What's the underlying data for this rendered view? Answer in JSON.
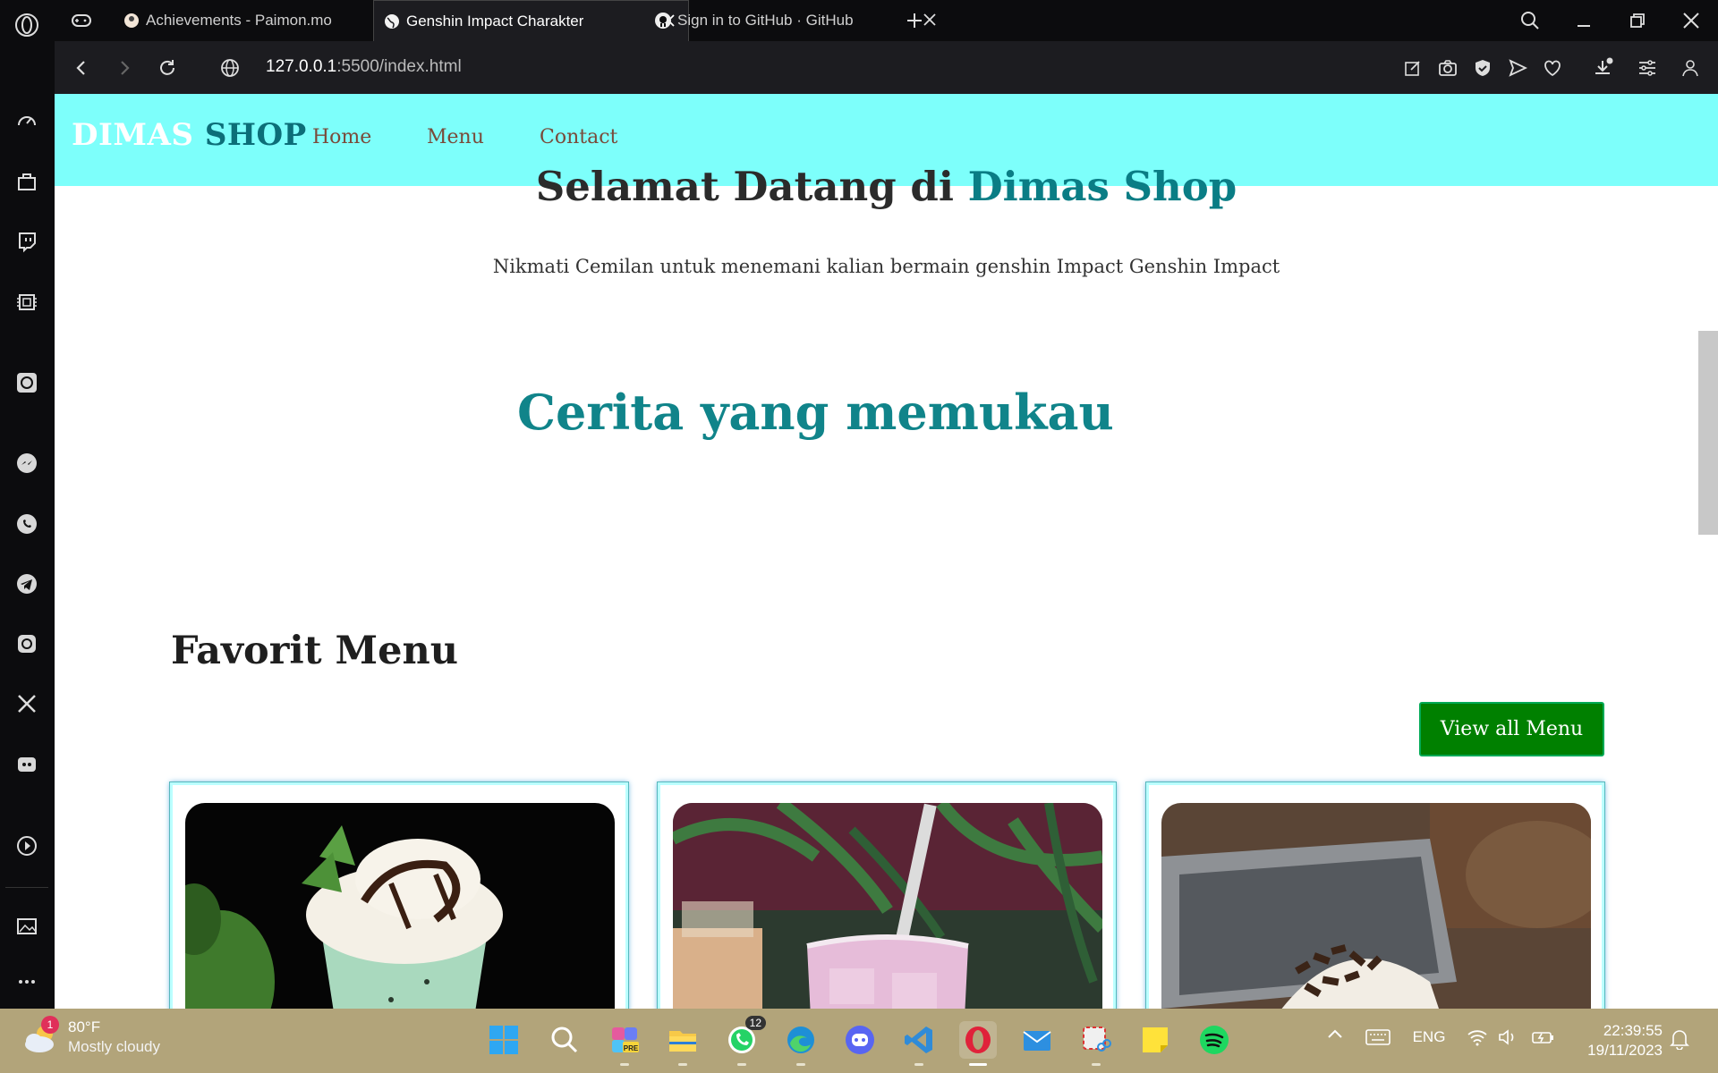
{
  "browser": {
    "tabs": [
      {
        "label": "Achievements - Paimon.mo",
        "icon": "paimon-icon",
        "active": false
      },
      {
        "label": "Genshin Impact Charakter",
        "icon": "globe-icon",
        "active": true
      },
      {
        "label": "Sign in to GitHub · GitHub",
        "icon": "github-icon",
        "active": false
      }
    ],
    "url_host": "127.0.0.1",
    "url_path": ":5500/index.html"
  },
  "site": {
    "logo_word1": "DIMAS",
    "logo_word2": "SHOP",
    "nav": [
      "Home",
      "Menu",
      "Contact"
    ],
    "welcome_part1": "Selamat Datang di ",
    "welcome_part2": "Dimas Shop",
    "subtitle": "Nikmati Cemilan untuk menemani kalian bermain genshin Impact Genshin Impact",
    "story_heading": "Cerita yang memukau",
    "favorites_title": "Favorit Menu",
    "view_all_label": "View all Menu",
    "cards": [
      {
        "image": "mint-chocolate-frappe-photo"
      },
      {
        "image": "berry-milk-drink-photo"
      },
      {
        "image": "chocolate-cake-photo"
      }
    ]
  },
  "taskbar": {
    "weather_temp": "80°F",
    "weather_desc": "Mostly cloudy",
    "weather_badge": "1",
    "whatsapp_badge": "12",
    "language": "ENG",
    "time": "22:39:55",
    "date": "19/11/2023"
  },
  "colors": {
    "nav_bg": "#7dfffb",
    "accent_teal": "#0a7d85",
    "button_green": "#008000",
    "taskbar_bg": "#b2a47a"
  }
}
